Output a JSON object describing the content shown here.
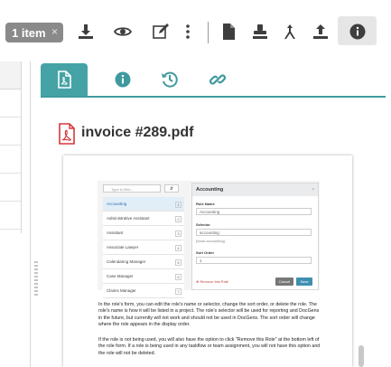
{
  "toolbar": {
    "selection_label": "1 item",
    "selection_close": "×",
    "buttons": [
      {
        "icon": "download-icon"
      },
      {
        "icon": "eye-icon"
      },
      {
        "icon": "edit-icon"
      },
      {
        "icon": "more-vertical-icon"
      },
      {
        "icon": "document-icon"
      },
      {
        "icon": "stamp-icon"
      },
      {
        "icon": "split-arrows-icon"
      },
      {
        "icon": "upload-icon"
      },
      {
        "icon": "info-icon"
      }
    ]
  },
  "tabs": [
    {
      "icon": "pdf-icon",
      "active": true
    },
    {
      "icon": "info-icon",
      "active": false
    },
    {
      "icon": "history-icon",
      "active": false
    },
    {
      "icon": "link-icon",
      "active": false
    }
  ],
  "file": {
    "title": "invoice #289.pdf"
  },
  "preview": {
    "filter_placeholder": "Type to filter...",
    "sort_label": "⇵",
    "roles": [
      {
        "name": "Accounting",
        "num": "1",
        "selected": true
      },
      {
        "name": "Administrative Assistant",
        "num": "2",
        "selected": false
      },
      {
        "name": "Assistant",
        "num": "3",
        "selected": false
      },
      {
        "name": "Associate Lawyer",
        "num": "4",
        "selected": false
      },
      {
        "name": "Calendaring Manager",
        "num": "5",
        "selected": false
      },
      {
        "name": "Case Manager",
        "num": "6",
        "selected": false
      },
      {
        "name": "Claims Manager",
        "num": "7",
        "selected": false
      }
    ],
    "edit_title": "Accounting",
    "edit_close": "×",
    "role_name_label": "Role Name",
    "role_name_value": "Accounting",
    "selector_label": "Selector",
    "selector_value": "accounting",
    "selector_help": "{team.accounting}",
    "sort_order_label": "Sort Order",
    "sort_order_value": "1",
    "remove_label": "⊗ Remove this Role",
    "cancel_label": "Cancel",
    "save_label": "Save",
    "paragraph1": "In the role's form, you can edit the role's name or selector, change the sort order, or delete the role. The role's name is how it will be listed in a project. The role's selector will be used for reporting and DocGens in the future, but currently will not work and should not be used in DocGens. The sort order will change where the role appears in the display order.",
    "paragraph2": "If the role is not being used, you will also have the option to click \"Remove this Role\" at the bottom left of the role form. If a role is being used in any taskflow or team assignment, you will not have this option and the role will not be deleted."
  },
  "colors": {
    "accent": "#45a3a6",
    "pdf_red": "#d8373a",
    "icon_dark": "#3e3e3e",
    "badge_gray": "#8a8a8a"
  }
}
